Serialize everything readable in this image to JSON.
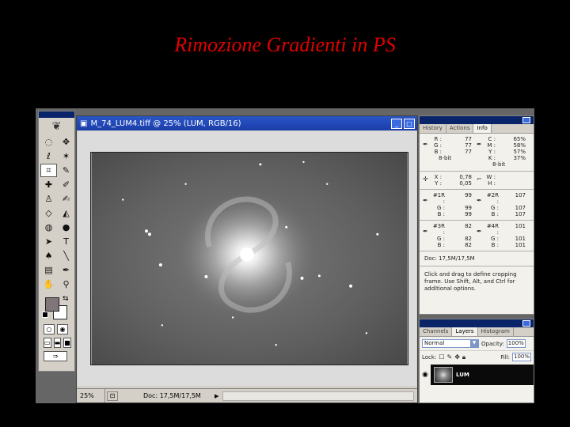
{
  "slide": {
    "title": "Rimozione Gradienti in PS"
  },
  "toolbox": {
    "feather_icon": "feather-icon",
    "tools": [
      {
        "name": "marquee-icon",
        "glyph": "◌"
      },
      {
        "name": "move-icon",
        "glyph": "✥"
      },
      {
        "name": "lasso-icon",
        "glyph": "ℓ"
      },
      {
        "name": "magic-wand-icon",
        "glyph": "✶"
      },
      {
        "name": "crop-icon",
        "glyph": "⌗"
      },
      {
        "name": "slice-icon",
        "glyph": "✎"
      },
      {
        "name": "healing-icon",
        "glyph": "✚"
      },
      {
        "name": "brush-icon",
        "glyph": "✐"
      },
      {
        "name": "stamp-icon",
        "glyph": "♙"
      },
      {
        "name": "history-brush-icon",
        "glyph": "✍"
      },
      {
        "name": "eraser-icon",
        "glyph": "◇"
      },
      {
        "name": "bucket-icon",
        "glyph": "◭"
      },
      {
        "name": "blur-icon",
        "glyph": "◍"
      },
      {
        "name": "dodge-icon",
        "glyph": "●"
      },
      {
        "name": "path-select-icon",
        "glyph": "➤"
      },
      {
        "name": "type-icon",
        "glyph": "T"
      },
      {
        "name": "pen-icon",
        "glyph": "♠"
      },
      {
        "name": "line-icon",
        "glyph": "╲"
      },
      {
        "name": "notes-icon",
        "glyph": "▤"
      },
      {
        "name": "eyedropper-icon",
        "glyph": "✒"
      },
      {
        "name": "hand-icon",
        "glyph": "✋"
      },
      {
        "name": "zoom-icon",
        "glyph": "⚲"
      }
    ],
    "colors": {
      "foreground": "#807679",
      "background": "#ffffff"
    }
  },
  "document": {
    "title": "M_74_LUM4.tiff @ 25% (LUM, RGB/16)",
    "zoom": "25%",
    "doc_info": "Doc: 17,5M/17,5M"
  },
  "info_palette": {
    "tabs": [
      "History",
      "Actions",
      "Info"
    ],
    "active_tab": "Info",
    "rgb": {
      "R": "77",
      "G": "77",
      "B": "77",
      "bit": "8-bit"
    },
    "cmyk": {
      "C": "65%",
      "M": "58%",
      "Y": "57%",
      "K": "37%",
      "bit": "8-bit"
    },
    "xy": {
      "X": "0,78",
      "Y": "0,05"
    },
    "wh": {
      "W": "",
      "H": ""
    },
    "s1": {
      "R": "99",
      "G": "99",
      "B": "99"
    },
    "s2": {
      "R": "107",
      "G": "107",
      "B": "107"
    },
    "s3": {
      "R": "82",
      "G": "82",
      "B": "82"
    },
    "s4": {
      "R": "101",
      "G": "101",
      "B": "101"
    },
    "labels": {
      "s1": "#1R :",
      "s2": "#2R :",
      "s3": "#3R :",
      "s4": "#4R :"
    },
    "doc_size": "Doc: 17,5M/17,5M",
    "hint": "Click and drag to define cropping frame. Use Shift, Alt, and Ctrl for additional options."
  },
  "layers_palette": {
    "tabs": [
      "Channels",
      "Layers",
      "Histogram"
    ],
    "active_tab": "Layers",
    "blend_mode": "Normal",
    "opacity_label": "Opacity:",
    "opacity": "100%",
    "lock_label": "Lock:",
    "fill_label": "Fill:",
    "fill": "100%",
    "layer_name": "LUM"
  }
}
